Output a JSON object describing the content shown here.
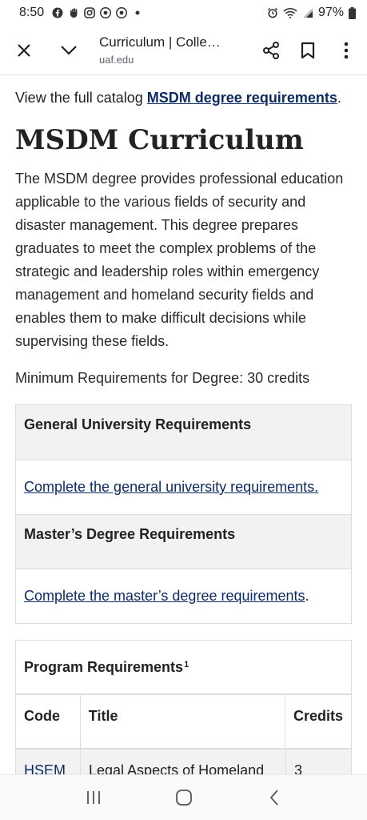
{
  "status_bar": {
    "time": "8:50",
    "battery": "97%",
    "left_icons": [
      "facebook-icon",
      "hand-icon",
      "instagram-icon",
      "chrome-icon",
      "chrome-icon",
      "dot-icon"
    ],
    "right_icons": [
      "alarm-icon",
      "wifi-icon",
      "signal-icon",
      "battery-icon"
    ]
  },
  "toolbar": {
    "title": "Curriculum | Colle…",
    "url": "uaf.edu"
  },
  "content": {
    "catalog_prefix": "View the full catalog ",
    "catalog_link": "MSDM degree requirements",
    "catalog_suffix": ".",
    "heading": "MSDM Curriculum",
    "intro": "The MSDM degree provides professional education applicable to the various fields of security and disaster management. This degree prepares graduates to meet the complex problems of the strategic and leadership roles within emergency management and homeland security fields and enables them to make difficult decisions while supervising these fields.",
    "min_requirements": "Minimum Requirements for Degree: 30 credits",
    "requirements_table": {
      "general_heading": "General University Requirements",
      "general_link": "Complete the general university requirements.",
      "masters_heading": "Master’s Degree Requirements",
      "masters_link": "Complete the master’s degree requirements",
      "masters_suffix": "."
    },
    "program_table": {
      "title": "Program Requirements",
      "footnote": "1",
      "headers": {
        "code": "Code",
        "title": "Title",
        "credits": "Credits"
      },
      "rows": [
        {
          "code": "HSEM",
          "title": "Legal Aspects of Homeland",
          "credits": "3"
        }
      ]
    }
  },
  "colors": {
    "link": "#0d2b63",
    "table_header_bg": "#f2f2f2",
    "border": "#dcdcdc"
  }
}
